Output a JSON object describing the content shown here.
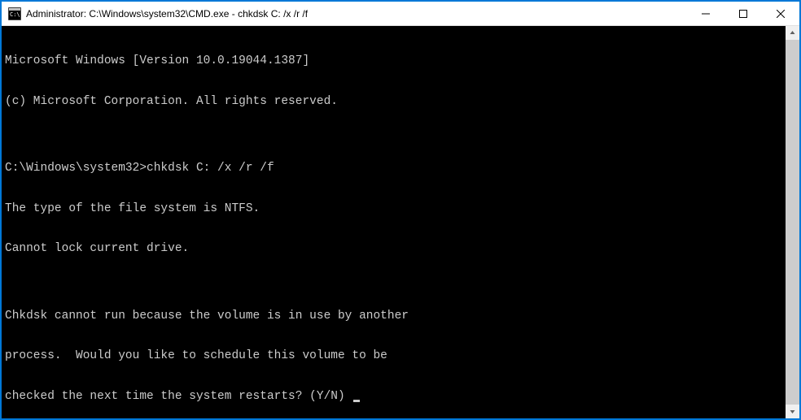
{
  "window": {
    "title": "Administrator: C:\\Windows\\system32\\CMD.exe - chkdsk  C: /x /r /f"
  },
  "terminal": {
    "line1": "Microsoft Windows [Version 10.0.19044.1387]",
    "line2": "(c) Microsoft Corporation. All rights reserved.",
    "blank1": "",
    "prompt_line": "C:\\Windows\\system32>chkdsk C: /x /r /f",
    "line3": "The type of the file system is NTFS.",
    "line4": "Cannot lock current drive.",
    "blank2": "",
    "line5": "Chkdsk cannot run because the volume is in use by another",
    "line6": "process.  Would you like to schedule this volume to be",
    "line7": "checked the next time the system restarts? (Y/N) "
  }
}
